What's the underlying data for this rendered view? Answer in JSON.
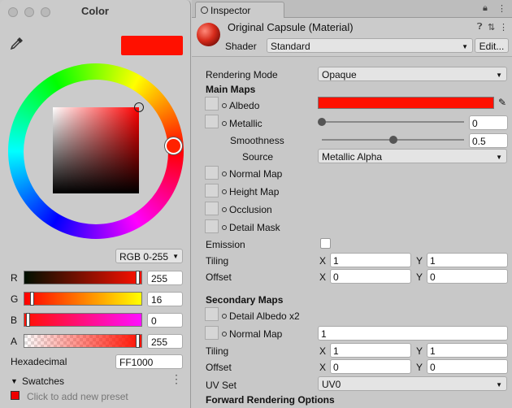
{
  "picker": {
    "title": "Color",
    "color_hex": "#FF1000",
    "mode": "RGB 0-255",
    "channels": [
      {
        "label": "R",
        "value": "255",
        "fraction": 1.0
      },
      {
        "label": "G",
        "value": "16",
        "fraction": 0.063
      },
      {
        "label": "B",
        "value": "0",
        "fraction": 0.0
      },
      {
        "label": "A",
        "value": "255",
        "fraction": 1.0
      }
    ],
    "hex_label": "Hexadecimal",
    "hex_value": "FF1000",
    "swatches_label": "Swatches",
    "swatches_add": "Click to add new preset"
  },
  "inspector": {
    "tab": "Inspector",
    "material_name": "Original Capsule (Material)",
    "shader_label": "Shader",
    "shader_value": "Standard",
    "edit_label": "Edit...",
    "rendering_mode_label": "Rendering Mode",
    "rendering_mode_value": "Opaque",
    "main_maps_label": "Main Maps",
    "albedo_label": "Albedo",
    "metallic_label": "Metallic",
    "metallic_value": "0",
    "metallic_fraction": 0.0,
    "smoothness_label": "Smoothness",
    "smoothness_value": "0.5",
    "smoothness_fraction": 0.5,
    "source_label": "Source",
    "source_value": "Metallic Alpha",
    "normal_map_label": "Normal Map",
    "height_map_label": "Height Map",
    "occlusion_label": "Occlusion",
    "detail_mask_label": "Detail Mask",
    "emission_label": "Emission",
    "tiling_label": "Tiling",
    "tiling_x": "1",
    "tiling_y": "1",
    "offset_label": "Offset",
    "offset_x": "0",
    "offset_y": "0",
    "axis_x": "X",
    "axis_y": "Y",
    "secondary_maps_label": "Secondary Maps",
    "detail_albedo_label": "Detail Albedo x2",
    "sec_normal_map_label": "Normal Map",
    "sec_normal_value": "1",
    "sec_tiling_label": "Tiling",
    "sec_tiling_x": "1",
    "sec_tiling_y": "1",
    "sec_offset_label": "Offset",
    "sec_offset_x": "0",
    "sec_offset_y": "0",
    "uv_set_label": "UV Set",
    "uv_set_value": "UV0",
    "forward_label": "Forward Rendering Options"
  }
}
